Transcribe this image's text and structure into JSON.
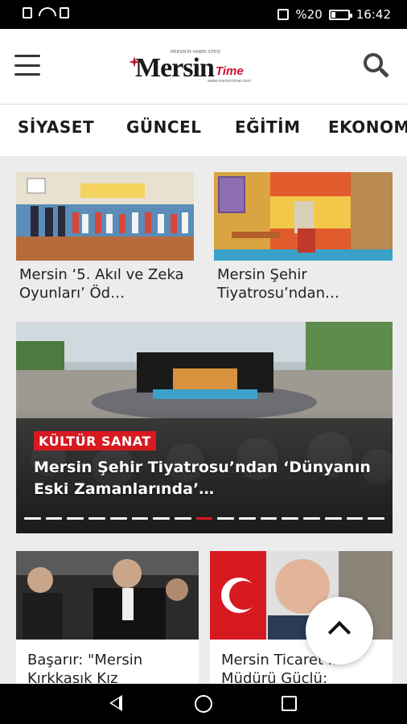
{
  "status_bar": {
    "left_icons": [
      "sim-icon",
      "wifi-icon",
      "nfc-icon"
    ],
    "battery_percent": "%20",
    "time": "16:42"
  },
  "header": {
    "logo_text": "Mersin",
    "logo_accent": "Time",
    "logo_slogan": "MERSİN'İN HABER SİTESİ",
    "logo_url": "www.mersintime.com"
  },
  "categories": [
    "SİYASET",
    "GÜNCEL",
    "EĞİTİM",
    "EKONOMİ"
  ],
  "top_cards": [
    {
      "title": "Mersin ‘5. Akıl ve Zeka Oyunları’ Öd…"
    },
    {
      "title": "Mersin Şehir Tiyatrosu’ndan…"
    }
  ],
  "hero": {
    "category": "KÜLTÜR SANAT",
    "title": "Mersin Şehir Tiyatrosu’ndan ‘Dünyanın Eski Zamanlarında’…",
    "slide_count": 17,
    "active_slide": 8
  },
  "bottom_cards": [
    {
      "title": "Başarır: \"Mersin Kırkkaşık Kız"
    },
    {
      "title": "Mersin Ticaret İl Müdürü Güçlü:"
    }
  ],
  "colors": {
    "accent": "#d71920",
    "logo_red": "#c8102e"
  }
}
